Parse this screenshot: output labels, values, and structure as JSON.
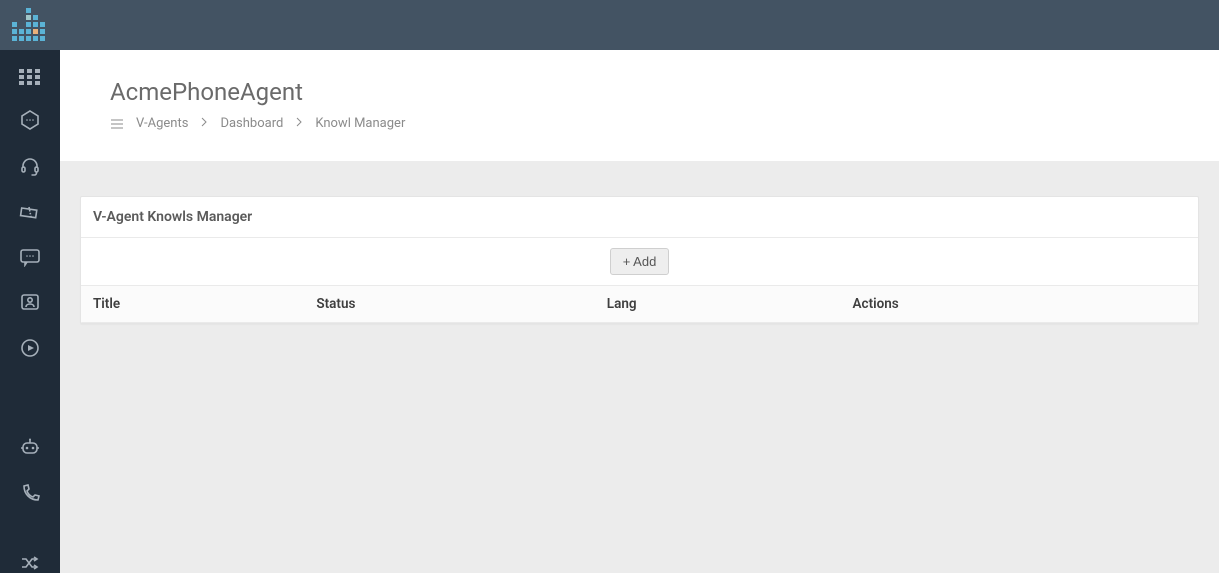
{
  "header": {
    "title": "AcmePhoneAgent",
    "breadcrumb": {
      "item1": "V-Agents",
      "item2": "Dashboard",
      "item3": "Knowl Manager"
    }
  },
  "panel": {
    "title": "V-Agent Knowls Manager",
    "add_label": "+ Add",
    "columns": {
      "c1": "Title",
      "c2": "Status",
      "c3": "Lang",
      "c4": "Actions"
    },
    "rows": []
  },
  "sidebar": {
    "items": [
      {
        "name": "apps"
      },
      {
        "name": "hexagon-chat"
      },
      {
        "name": "headset"
      },
      {
        "name": "ticket"
      },
      {
        "name": "message"
      },
      {
        "name": "contact-card"
      },
      {
        "name": "play-circle"
      },
      {
        "name": "robot"
      },
      {
        "name": "phone"
      },
      {
        "name": "shuffle"
      }
    ]
  }
}
